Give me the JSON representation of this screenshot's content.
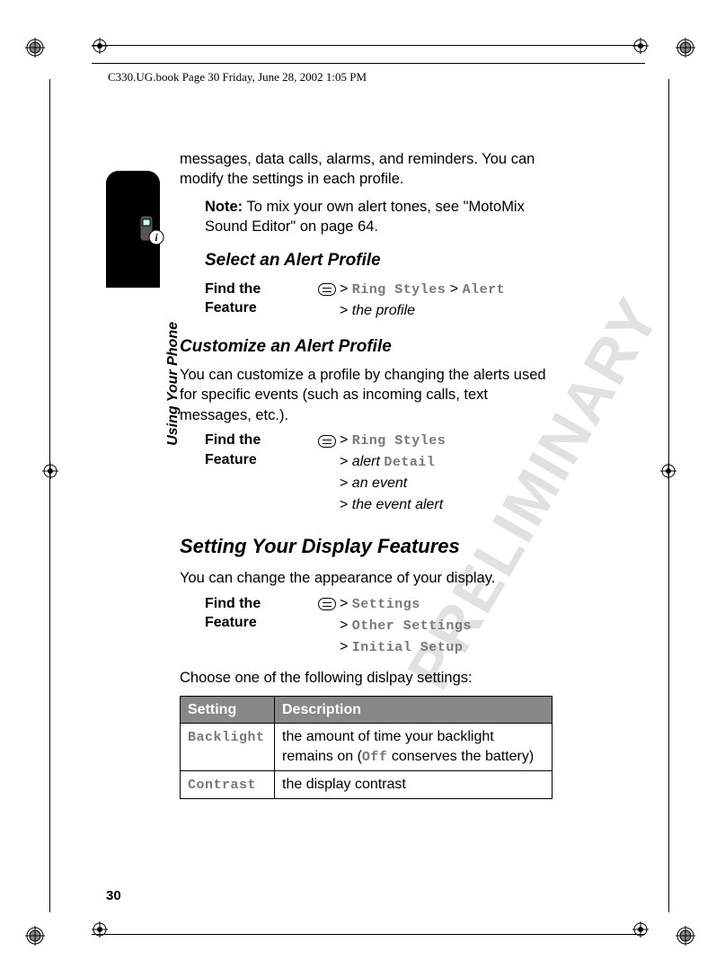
{
  "header": {
    "running": "C330.UG.book  Page 30  Friday, June 28, 2002  1:05 PM"
  },
  "side": {
    "label": "Using Your Phone"
  },
  "watermark": "PRELIMINARY",
  "page_number": "30",
  "intro": "messages, data calls, alarms, and reminders. You can modify the settings in each profile.",
  "note": {
    "label": "Note:",
    "text": " To mix your own alert tones, see \"MotoMix Sound Editor\" on page 64."
  },
  "sec1": {
    "title": "Select an Alert Profile",
    "ftf_label": "Find the Feature",
    "steps": {
      "l1a": "> ",
      "l1b": "Ring Styles",
      "l1c": " > ",
      "l1d": "Alert",
      "l2a": "> ",
      "l2b": "the profile"
    }
  },
  "sec2": {
    "title": "Customize an Alert Profile",
    "body": "You can customize a profile by changing the alerts used for specific events (such as incoming calls, text messages, etc.).",
    "ftf_label": "Find the Feature",
    "steps": {
      "l1a": "> ",
      "l1b": "Ring Styles",
      "l2a": "> ",
      "l2b": "alert",
      "l2c": " ",
      "l2d": "Detail",
      "l3a": "> ",
      "l3b": "an event",
      "l4a": "> ",
      "l4b": "the event alert"
    }
  },
  "sec3": {
    "title": "Setting Your Display Features",
    "body": "You can change the appearance of your display.",
    "ftf_label": "Find the Feature",
    "steps": {
      "l1a": "> ",
      "l1b": "Settings",
      "l2a": "> ",
      "l2b": "Other Settings",
      "l3a": "> ",
      "l3b": "Initial Setup"
    },
    "body2": "Choose one of the following dislpay settings:",
    "table": {
      "h1": "Setting",
      "h2": "Description",
      "r1c1": "Backlight",
      "r1c2a": "the amount of time your backlight remains on (",
      "r1c2b": "Off",
      "r1c2c": " conserves the battery)",
      "r2c1": "Contrast",
      "r2c2": "the display contrast"
    }
  }
}
